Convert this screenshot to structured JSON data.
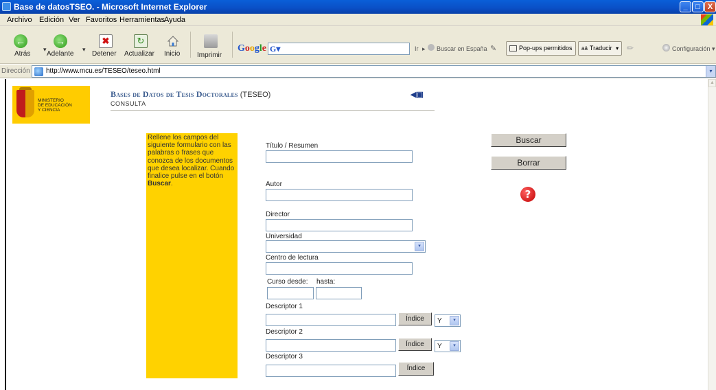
{
  "window": {
    "title": "Base de datosTSEO. - Microsoft Internet Explorer",
    "min_label": "_",
    "max_label": "□",
    "close_label": "X"
  },
  "menu": [
    "Archivo",
    "Edición",
    "Ver",
    "Favoritos",
    "Herramientas",
    "Ayuda"
  ],
  "toolbar": {
    "back": "Atrás",
    "forward": "Adelante",
    "stop": "Detener",
    "refresh": "Actualizar",
    "home": "Inicio",
    "print": "Imprimir",
    "chevron": "▾"
  },
  "google_bar": {
    "label_parts": [
      "G",
      "o",
      "o",
      "g",
      "l",
      "e"
    ],
    "search_icon": "G▾",
    "go": "Ir",
    "search_spain": "Buscar en España",
    "popups": "Pop-ups permitidos",
    "translate": "Traducir",
    "settings": "Configuración"
  },
  "address": {
    "label": "Dirección",
    "url": "http://www.mcu.es/TESEO/teseo.html",
    "dropdown": "▾"
  },
  "logo": {
    "lines": [
      "MINISTERIO",
      "DE EDUCACIÓN",
      "Y CIENCIA"
    ]
  },
  "header": {
    "title_sc": "Bases de Datos de Tesis Doctorales",
    "title_rest": " (TESEO)",
    "subtitle": "CONSULTA",
    "nav_icon": "◀▣"
  },
  "instructions": {
    "text": "Rellene los campos del siguiente formulario con las palabras o frases que conozca de los documentos que desea localizar. Cuando finalice pulse en el botón ",
    "bold": "Buscar",
    "end": "."
  },
  "form": {
    "titulo_label": "Título / Resumen",
    "autor_label": "Autor",
    "director_label": "Director",
    "universidad_label": "Universidad",
    "universidad_value": "",
    "centro_label": "Centro de lectura",
    "curso_label": "Curso desde:",
    "hasta_label": "hasta:",
    "descriptor1_label": "Descriptor 1",
    "descriptor2_label": "Descriptor 2",
    "descriptor3_label": "Descriptor 3",
    "indice_label": "Índice",
    "op1_value": "Y",
    "op2_value": "Y",
    "select_arrow": "▾"
  },
  "actions": {
    "buscar": "Buscar",
    "borrar": "Borrar",
    "help_icon": "?"
  },
  "colors": {
    "instruction_bg": "#ffd200",
    "logo_bg": "#ffcc00",
    "title_blue": "#3a5b8e",
    "help_red": "#c00000"
  }
}
